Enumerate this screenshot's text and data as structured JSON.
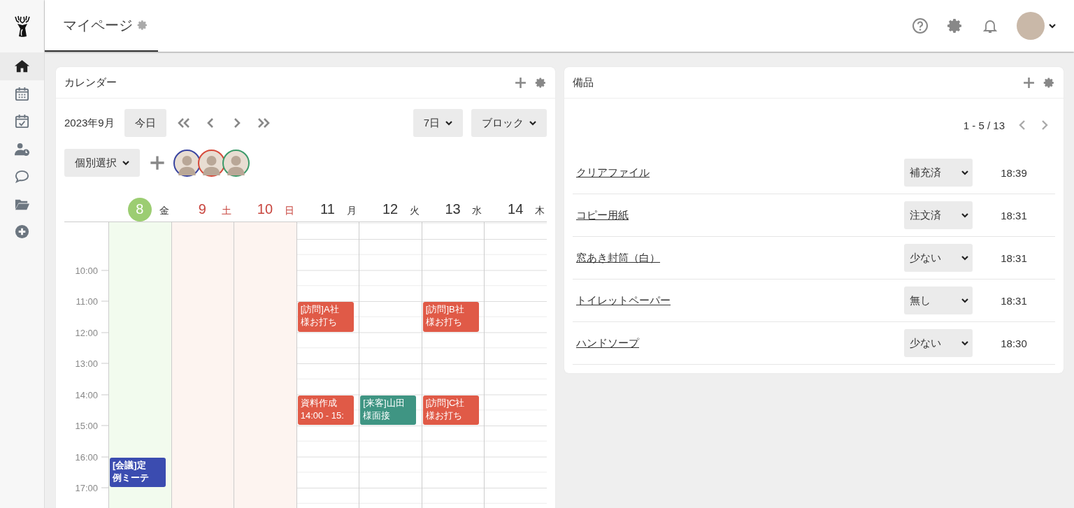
{
  "sidebar": {
    "items": [
      {
        "kind": "home",
        "selected": true
      },
      {
        "kind": "calendar",
        "selected": false
      },
      {
        "kind": "calendar-check",
        "selected": false
      },
      {
        "kind": "user-clock",
        "selected": false
      },
      {
        "kind": "chat",
        "selected": false
      },
      {
        "kind": "folder",
        "selected": false
      },
      {
        "kind": "add",
        "selected": false
      }
    ]
  },
  "header": {
    "tab_title": "マイページ"
  },
  "calendar": {
    "title": "カレンダー",
    "month": "2023年9月",
    "today_button": "今日",
    "range_select": "7日",
    "view_select": "ブロック",
    "member_select": "個別選択",
    "members": [
      {
        "color": "#3a45a0"
      },
      {
        "color": "#d64a3a"
      },
      {
        "color": "#3c9a6a"
      }
    ],
    "days": [
      {
        "number": "8",
        "weekday": "金",
        "kind": "today"
      },
      {
        "number": "9",
        "weekday": "土",
        "kind": "holiday"
      },
      {
        "number": "10",
        "weekday": "日",
        "kind": "holiday"
      },
      {
        "number": "11",
        "weekday": "月",
        "kind": "normal"
      },
      {
        "number": "12",
        "weekday": "火",
        "kind": "normal"
      },
      {
        "number": "13",
        "weekday": "水",
        "kind": "normal"
      },
      {
        "number": "14",
        "weekday": "木",
        "kind": "normal"
      }
    ],
    "times": [
      "10:00",
      "11:00",
      "12:00",
      "13:00",
      "14:00",
      "15:00",
      "16:00",
      "17:00"
    ],
    "events": [
      {
        "lines": [
          "[訪問]A社",
          "様お打ち"
        ],
        "color": "#e05a47"
      },
      {
        "lines": [
          "[訪問]B社",
          "様お打ち"
        ],
        "color": "#e05a47"
      },
      {
        "lines": [
          "資料作成",
          "14:00 - 15:"
        ],
        "color": "#e05a47"
      },
      {
        "lines": [
          "[来客]山田",
          "様面接"
        ],
        "color": "#3f9583"
      },
      {
        "lines": [
          "[訪問]C社",
          "様お打ち"
        ],
        "color": "#e05a47"
      },
      {
        "lines": [
          "[会議]定",
          "例ミーテ"
        ],
        "color": "#3b4cb0"
      }
    ]
  },
  "equipment": {
    "title": "備品",
    "pager": "1 - 5 / 13",
    "items": [
      {
        "name": "クリアファイル",
        "status": "補充済",
        "time": "18:39"
      },
      {
        "name": "コピー用紙",
        "status": "注文済",
        "time": "18:31"
      },
      {
        "name": "窓あき封筒（白）",
        "status": "少ない",
        "time": "18:31"
      },
      {
        "name": "トイレットペーパー",
        "status": "無し",
        "time": "18:31"
      },
      {
        "name": "ハンドソープ",
        "status": "少ない",
        "time": "18:30"
      }
    ]
  }
}
